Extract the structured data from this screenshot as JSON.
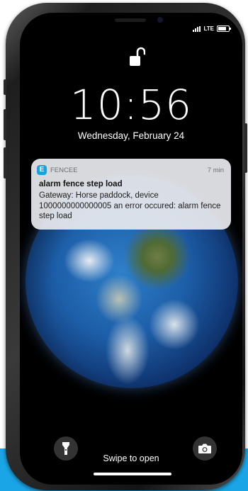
{
  "status_bar": {
    "network": "LTE"
  },
  "lock_screen": {
    "time": "10:56",
    "date": "Wednesday, February 24",
    "swipe_text": "Swipe to open"
  },
  "notification": {
    "app_name": "FENCEE",
    "app_icon_letter": "e",
    "time_ago": "7 min",
    "title": "alarm fence step load",
    "body": "Gateway: Horse paddock, device 1000000000000005 an error occured: alarm fence step load"
  },
  "icons": {
    "lock": "unlocked-padlock-icon",
    "flashlight": "flashlight-icon",
    "camera": "camera-icon"
  },
  "colors": {
    "accent": "#1aa6e6",
    "app_icon": "#1aa0e2",
    "notification_bg": "#e8eaee"
  }
}
